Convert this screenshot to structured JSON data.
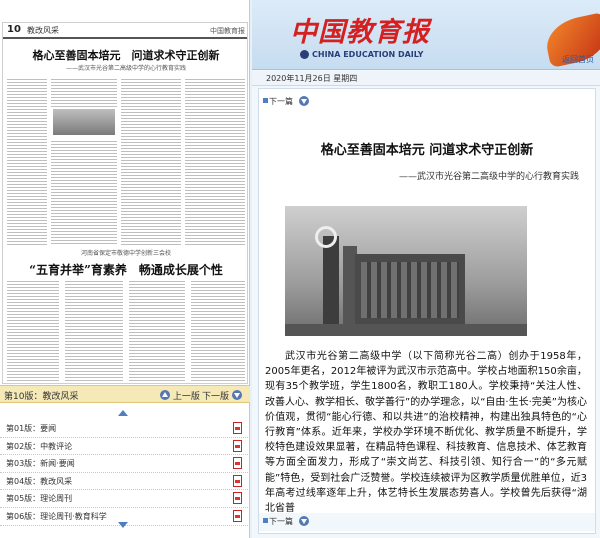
{
  "left": {
    "paper": {
      "page_number": "10",
      "section": "教改风采",
      "masthead": "中国教育报",
      "headline1": "格心至善固本培元　问道求术守正创新",
      "subhead1": "——武汉市光谷第二高级中学的心行教育实践",
      "kicker2": "河南省保定市敬德中学创新三会校",
      "headline2": "“五育并举”育素养　畅通成长展个性"
    },
    "pagebar": {
      "current": "第10版：教改风采",
      "prev": "上一版",
      "next": "下一版"
    },
    "pages": [
      {
        "label": "第01版：要闻"
      },
      {
        "label": "第02版：中教评论"
      },
      {
        "label": "第03版：新闻·要闻"
      },
      {
        "label": "第04版：教改风采"
      },
      {
        "label": "第05版：理论周刊"
      },
      {
        "label": "第06版：理论周刊·教育科学"
      }
    ]
  },
  "right": {
    "logo_cn": "中国教育报",
    "logo_en": "CHINA EDUCATION DAILY",
    "back_link": "返回首页",
    "date": "2020年11月26日 星期四",
    "next_article_top": "下一篇",
    "next_article_bottom": "下一篇",
    "article": {
      "title": "格心至善固本培元 问道求术守正创新",
      "subtitle": "——武汉市光谷第二高级中学的心行教育实践",
      "body": "武汉市光谷第二高级中学（以下简称光谷二高）创办于1958年，2005年更名，2012年被评为武汉市示范高中。学校占地面积150余亩，现有35个教学班，学生1800名，教职工180人。学校秉持“关注人性、改善人心、教学相长、敬学善行”的办学理念，以“自由·生长·完美”为核心价值观，贯彻“能心行德、和以共进”的治校精神，构建出独具特色的“心行教育”体系。近年来，学校办学环境不断优化、教学质量不断提升，学校特色建设效果显著，在精品特色课程、科技教育、信息技术、体艺教育等方面全面发力，形成了“崇文尚艺、科技引领、知行合一”的“多元赋能”特色，受到社会广泛赞誉。学校连续被评为区教学质量优胜单位，近3年高考过线率逐年上升，体艺特长生发展态势喜人。学校曾先后获得“湖北省普"
    }
  }
}
